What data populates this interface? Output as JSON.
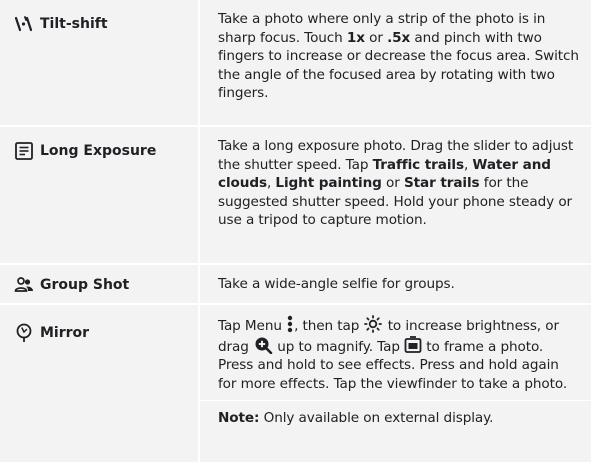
{
  "rows": [
    {
      "name": "Tilt-shift",
      "icon": "tilt-shift-icon",
      "desc": {
        "p1": "Take a photo where only a strip of the photo is in sharp focus. Touch ",
        "b1": "1x",
        "p2": " or ",
        "b2": ".5x",
        "p3": " and pinch with two fingers to increase or decrease the focus area. Switch the angle of the focused area by rotating with two fingers."
      }
    },
    {
      "name": "Long Exposure",
      "icon": "long-exposure-icon",
      "desc": {
        "p1": "Take a long exposure photo. Drag the slider to adjust the shutter speed. Tap ",
        "b1": "Traffic trails",
        "p2": ", ",
        "b2": "Water and clouds",
        "p3": ", ",
        "b3": "Light painting",
        "p4": " or ",
        "b4": "Star trails",
        "p5": " for the suggested shutter speed. Hold your phone steady or use a tripod to capture motion."
      }
    },
    {
      "name": "Group Shot",
      "icon": "group-shot-icon",
      "desc": {
        "p1": "Take a wide-angle selfie for groups."
      }
    },
    {
      "name": "Mirror",
      "icon": "mirror-icon",
      "desc": {
        "p1": "Tap Menu ",
        "p2": ", then tap ",
        "p3": " to increase brightness, or drag ",
        "p4": " up to magnify. Tap ",
        "p5": " to frame a photo. Press and hold to see effects. Press and hold again for more effects. Tap the viewfinder to take a photo.",
        "note_label": "Note:",
        "note_text": " Only available on external display."
      },
      "inline_icons": [
        "more-vert-icon",
        "brightness-icon",
        "zoom-in-icon",
        "frame-icon"
      ]
    }
  ]
}
